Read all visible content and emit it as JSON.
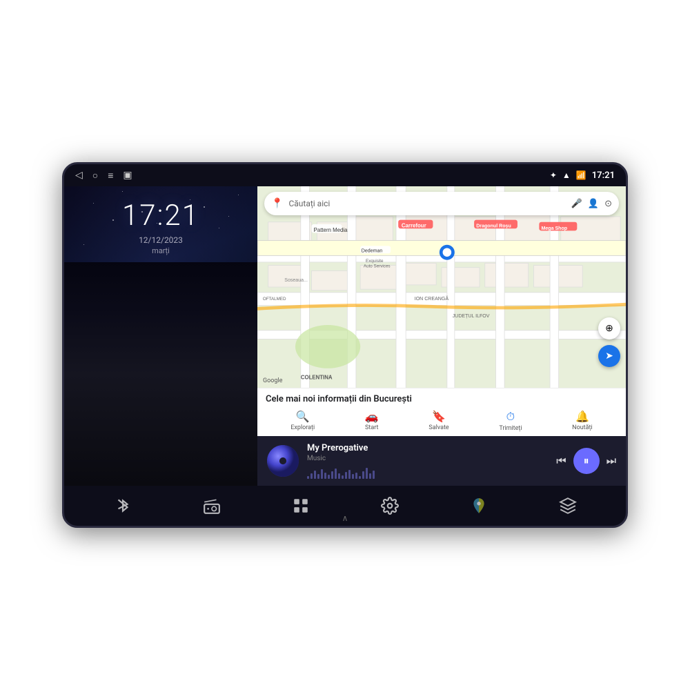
{
  "device": {
    "statusBar": {
      "time": "17:21",
      "navBack": "◁",
      "navHome": "○",
      "navMenu": "≡",
      "navRecent": "▣"
    },
    "leftPanel": {
      "clock": "17:21",
      "date": "12/12/2023",
      "day": "marți"
    },
    "map": {
      "searchPlaceholder": "Căutați aici",
      "infoTitle": "Cele mai noi informații din București",
      "tabs": [
        {
          "label": "Explorați",
          "icon": "🔍"
        },
        {
          "label": "Start",
          "icon": "🚗"
        },
        {
          "label": "Salvate",
          "icon": "🔖"
        },
        {
          "label": "Trimiteți",
          "icon": "⏱"
        },
        {
          "label": "Noutăți",
          "icon": "🔔"
        }
      ],
      "googleLogo": "Google",
      "locationLabels": [
        "Pattern Media",
        "Carrefour",
        "Dragonul Roșu",
        "Dedeman",
        "Mega Shop",
        "Exquisite Auto Services",
        "OFTALMED",
        "ION CREANGĂ",
        "JUDEȚUL ILFOV",
        "COLENTINA"
      ]
    },
    "musicPlayer": {
      "title": "My Prerogative",
      "subtitle": "Music",
      "prevBtn": "⏮",
      "playBtn": "⏸",
      "nextBtn": "⏭"
    },
    "bottomDock": {
      "items": [
        {
          "icon": "bluetooth",
          "label": ""
        },
        {
          "icon": "radio",
          "label": ""
        },
        {
          "icon": "apps",
          "label": ""
        },
        {
          "icon": "settings",
          "label": ""
        },
        {
          "icon": "maps",
          "label": ""
        },
        {
          "icon": "cube",
          "label": ""
        }
      ]
    }
  }
}
